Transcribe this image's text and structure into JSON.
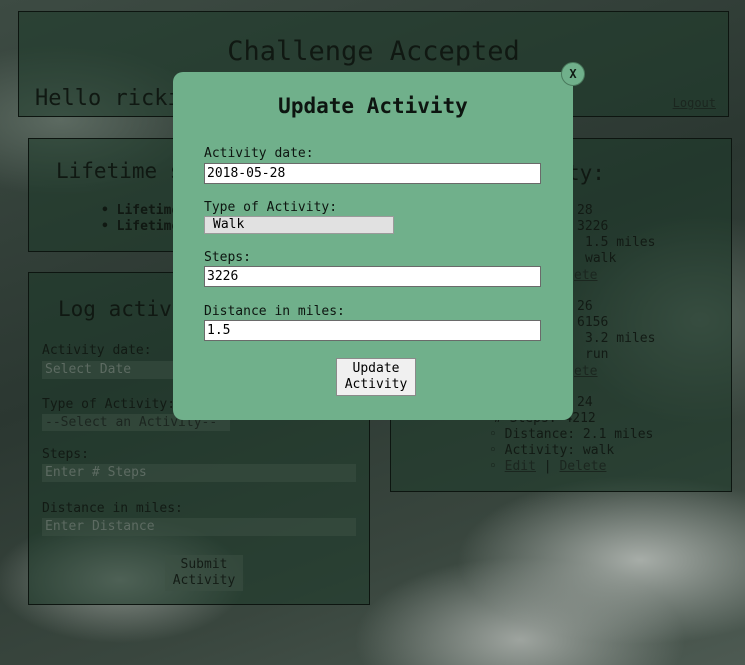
{
  "header": {
    "title": "Challenge Accepted",
    "greeting": "Hello rickit",
    "logout": "Logout"
  },
  "lifetime": {
    "title": "Lifetime s",
    "items": [
      "Lifetime",
      "Lifetime"
    ]
  },
  "log_form": {
    "title": "Log activi",
    "date_label": "Activity date:",
    "date_placeholder": "Select Date",
    "type_label": "Type of Activity:",
    "type_value": "--Select an Activity--",
    "steps_label": "Steps:",
    "steps_placeholder": "Enter # Steps",
    "distance_label": "Distance in miles:",
    "distance_placeholder": "Enter Distance",
    "submit_line1": "Submit",
    "submit_line2": "Activity"
  },
  "activities": {
    "title": "ty:",
    "entries": [
      {
        "date": "28",
        "steps": "3226",
        "distance": "1.5 miles",
        "type": "walk",
        "delete": "ete"
      },
      {
        "date": "26",
        "steps": "6156",
        "distance": "3.2 miles",
        "type": "run",
        "delete": "ete"
      },
      {
        "date": "24",
        "steps": "# Steps: 4212",
        "distance": "Distance: 2.1 miles",
        "type": "Activity: walk",
        "edit": "Edit",
        "sep": "|",
        "delete": "Delete"
      }
    ]
  },
  "modal": {
    "close": "X",
    "title": "Update Activity",
    "date_label": "Activity date:",
    "date_value": "2018-05-28",
    "type_label": "Type of Activity:",
    "type_value": "Walk",
    "steps_label": "Steps:",
    "steps_value": "3226",
    "distance_label": "Distance in miles:",
    "distance_value": "1.5",
    "button_line1": "Update",
    "button_line2": "Activity"
  },
  "colors": {
    "modal_bg": "#70b08b",
    "panel_bg": "#1e3a2a"
  }
}
